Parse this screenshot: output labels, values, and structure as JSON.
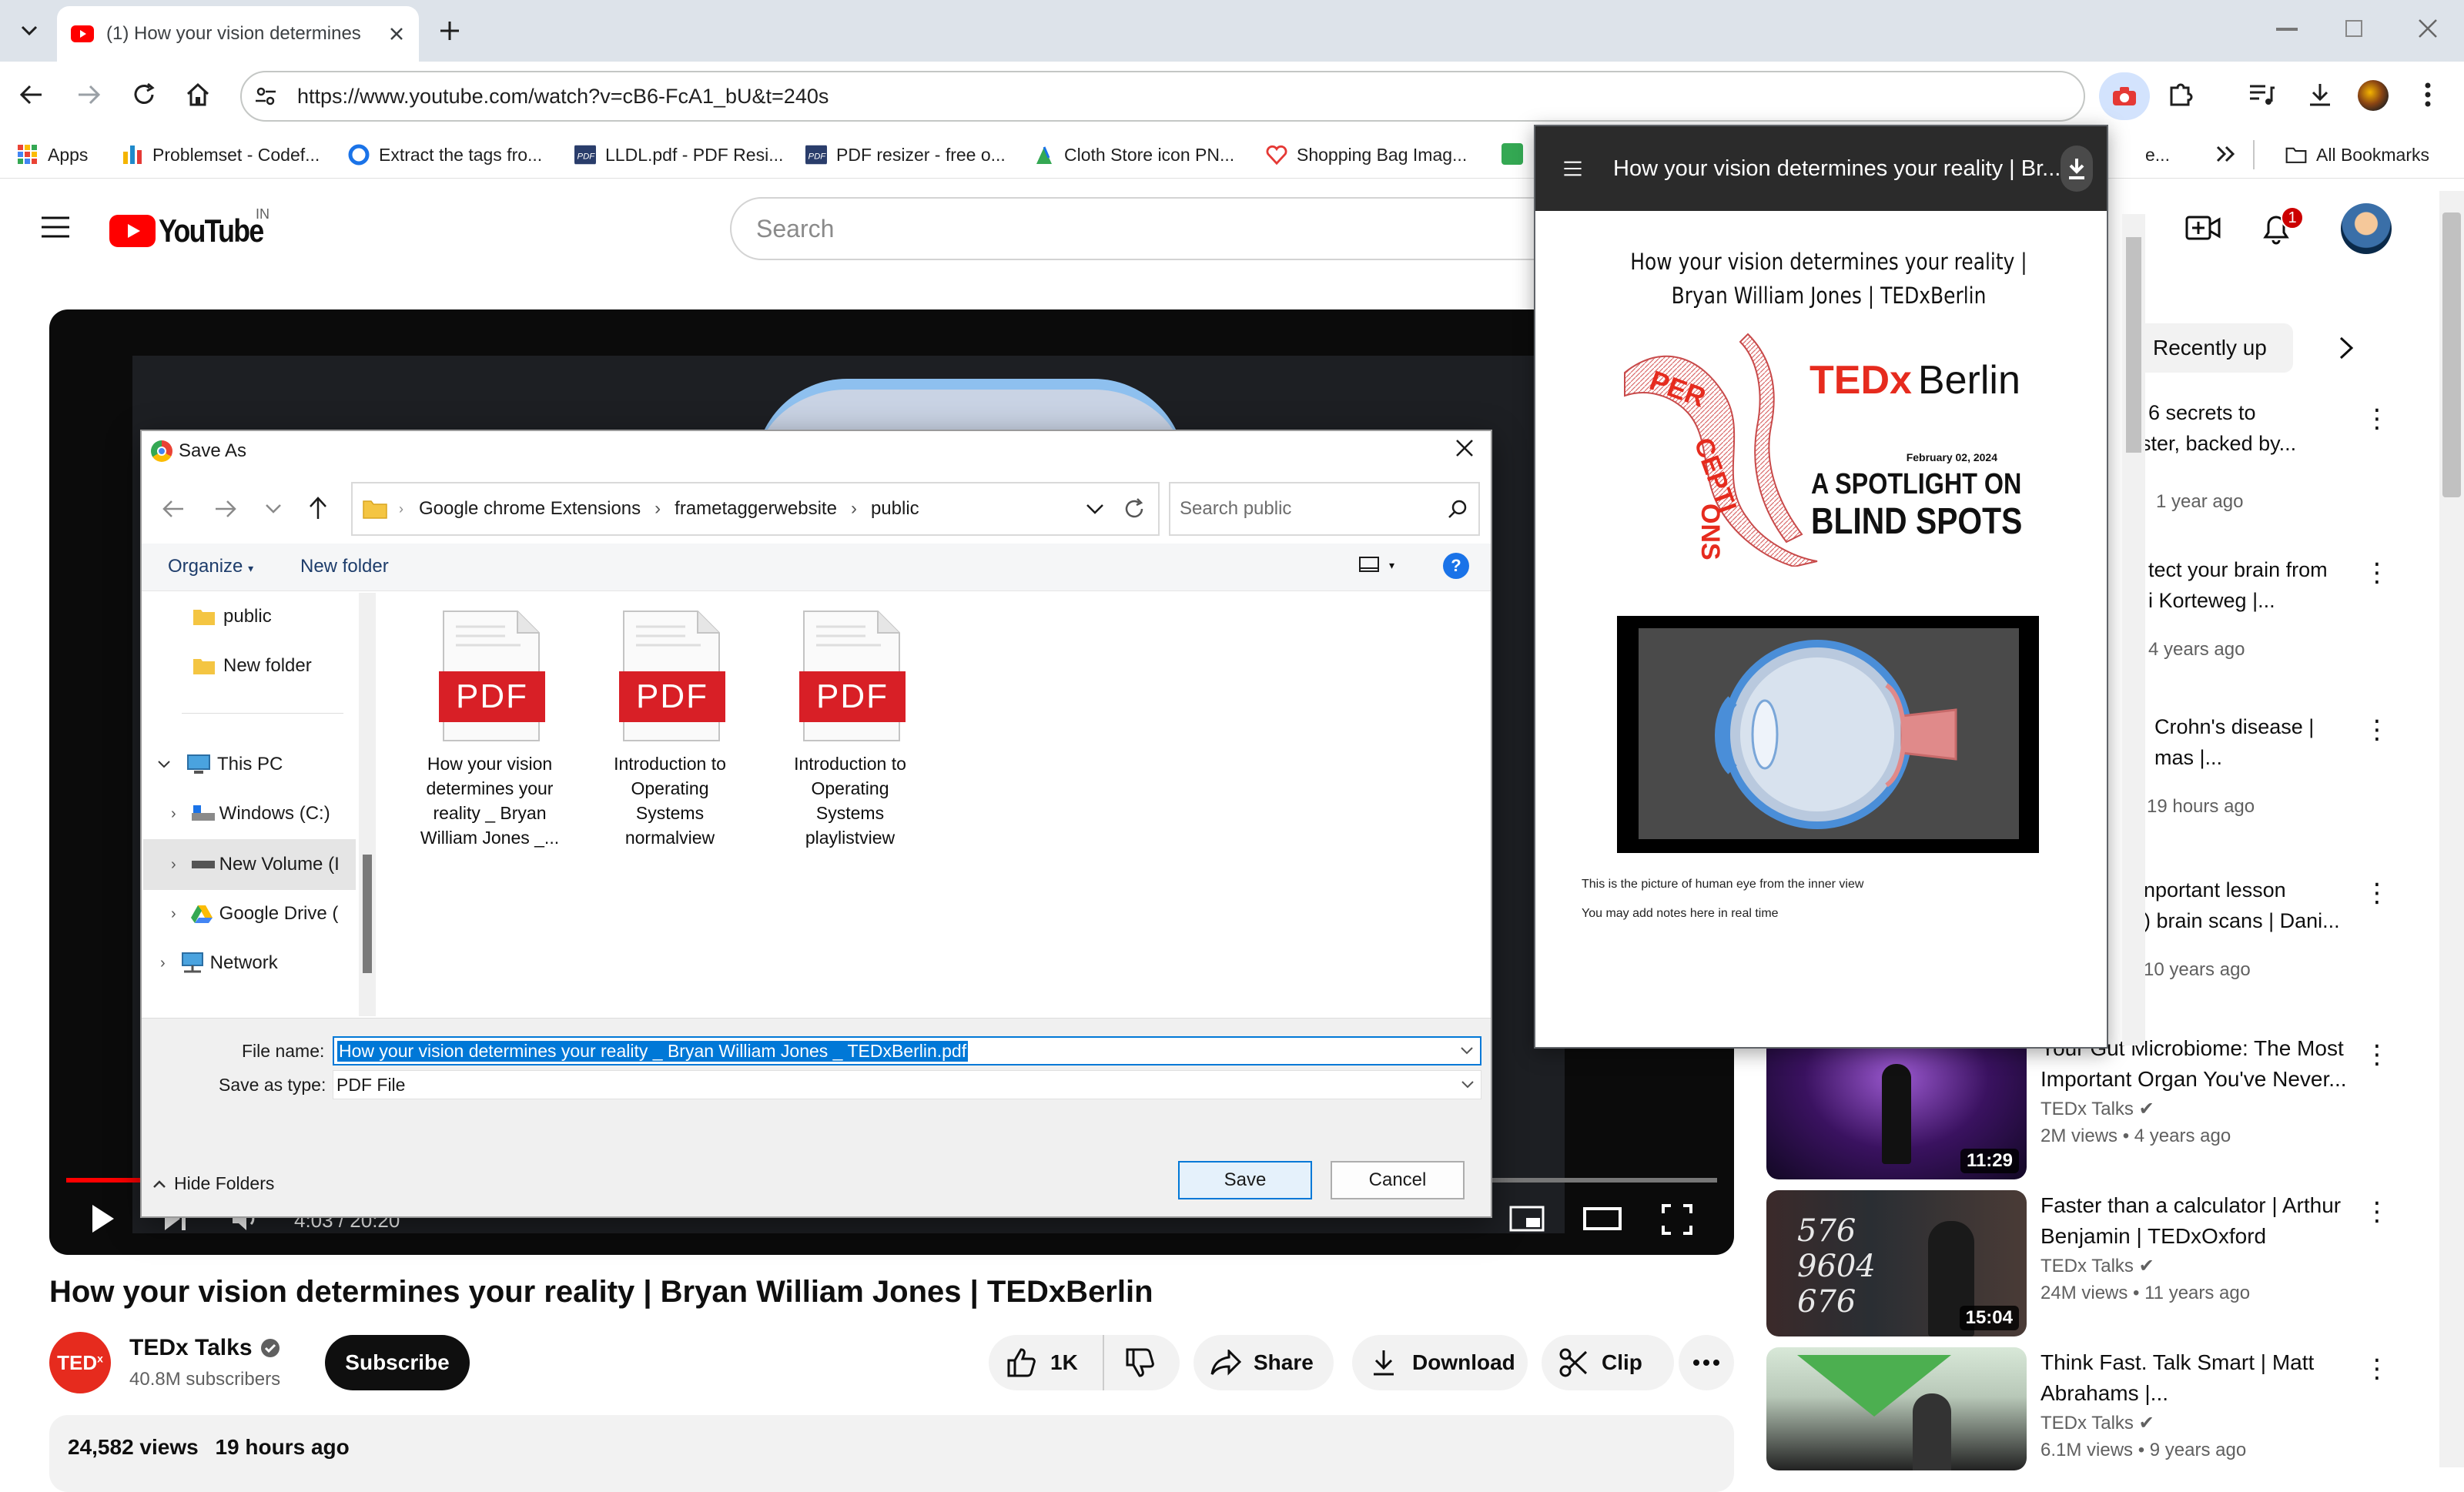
{
  "browser": {
    "tab_title": "(1) How your vision determines",
    "url": "https://www.youtube.com/watch?v=cB6-FcA1_bU&t=240s",
    "bookmarks": [
      {
        "label": "Apps",
        "color": "#4285f4"
      },
      {
        "label": "Problemset - Codef...",
        "color": "#1f8acb"
      },
      {
        "label": "Extract the tags fro...",
        "color": "#1a73e8"
      },
      {
        "label": "LLDL.pdf - PDF Resi...",
        "color": "#2a3d6b"
      },
      {
        "label": "PDF resizer - free o...",
        "color": "#2a3d6b"
      },
      {
        "label": "Cloth Store icon PN...",
        "color": "#34a853"
      },
      {
        "label": "Shopping Bag Imag...",
        "color": "#e53935"
      }
    ],
    "bookmark_partial": "e...",
    "all_bookmarks": "All Bookmarks"
  },
  "youtube": {
    "logo_text": "YouTube",
    "region": "IN",
    "search_placeholder": "Search",
    "notification_count": "1",
    "video_time": "4:03 / 20:20",
    "video_title": "How your vision determines your reality | Bryan William Jones | TEDxBerlin",
    "channel_name": "TEDx Talks",
    "subscribers": "40.8M subscribers",
    "subscribe_label": "Subscribe",
    "likes": "1K",
    "share_label": "Share",
    "download_label": "Download",
    "clip_label": "Clip",
    "views": "24,582 views",
    "posted": "19 hours ago",
    "chip_recent": "Recently up",
    "sidebar_videos": [
      {
        "title": "6 secrets to ...ster, backed by...",
        "line1": "6 secrets to",
        "line2": "ster, backed by...",
        "meta": "1 year ago"
      },
      {
        "line1": "tect your brain from",
        "line2": "i Korteweg |...",
        "meta": "4 years ago"
      },
      {
        "line1": "Crohn's disease |",
        "line2": "mas |...",
        "meta": "19 hours ago"
      },
      {
        "line1": "nportant lesson",
        "line2": ") brain scans | Dani...",
        "meta": "10 years ago"
      }
    ],
    "recommended": [
      {
        "title": "Your Gut Microbiome: The Most Important Organ You've Never...",
        "channel": "TEDx Talks",
        "meta": "2M views  • 4 years ago",
        "duration": "11:29"
      },
      {
        "title": "Faster than a calculator | Arthur Benjamin | TEDxOxford",
        "channel": "TEDx Talks",
        "meta": "24M views  • 11 years ago",
        "duration": "15:04"
      },
      {
        "title": "Think Fast. Talk Smart | Matt Abrahams |...",
        "channel": "TEDx Talks",
        "meta": "6.1M views  • 9 years ago",
        "duration": ""
      }
    ]
  },
  "extension": {
    "header_title": "How your vision determines your reality | Br...",
    "doc_title": "How your vision determines your reality | Bryan William Jones | TEDxBerlin",
    "tedx_brand": "TEDx Berlin",
    "tedx_tedx": "TEDx",
    "tedx_city": "Berlin",
    "tedx_date": "February 02, 2024",
    "tedx_tag1": "A SPOTLIGHT ON",
    "tedx_tag2": "BLIND SPOTS",
    "perceptions": "PERCEPTIONS",
    "note1": "This is the picture of human eye from the inner view",
    "note2": "You may add notes here in real time"
  },
  "dialog": {
    "title": "Save As",
    "path": [
      "Google chrome Extensions",
      "frametaggerwebsite",
      "public"
    ],
    "search_placeholder": "Search public",
    "organize": "Organize",
    "new_folder": "New folder",
    "nav": {
      "public": "public",
      "new_folder": "New folder",
      "this_pc": "This PC",
      "windows": "Windows (C:)",
      "new_volume": "New Volume (I",
      "gdrive": "Google Drive (",
      "network": "Network"
    },
    "files": [
      {
        "badge": "PDF",
        "name": "How your vision determines your reality _ Bryan William Jones _..."
      },
      {
        "badge": "PDF",
        "name": "Introduction to Operating Systems normalview"
      },
      {
        "badge": "PDF",
        "name": "Introduction to Operating Systems playlistview"
      }
    ],
    "file_name_label": "File name:",
    "file_name_value": "How your vision determines your reality _ Bryan William Jones _ TEDxBerlin.pdf",
    "save_type_label": "Save as type:",
    "save_type_value": "PDF File",
    "hide_folders": "Hide Folders",
    "save_label": "Save",
    "cancel_label": "Cancel"
  },
  "colors": {
    "yt_red": "#ff0000",
    "pdf_red": "#d81f26",
    "win_blue": "#0078d7",
    "popup_header": "#2b2b2b"
  }
}
